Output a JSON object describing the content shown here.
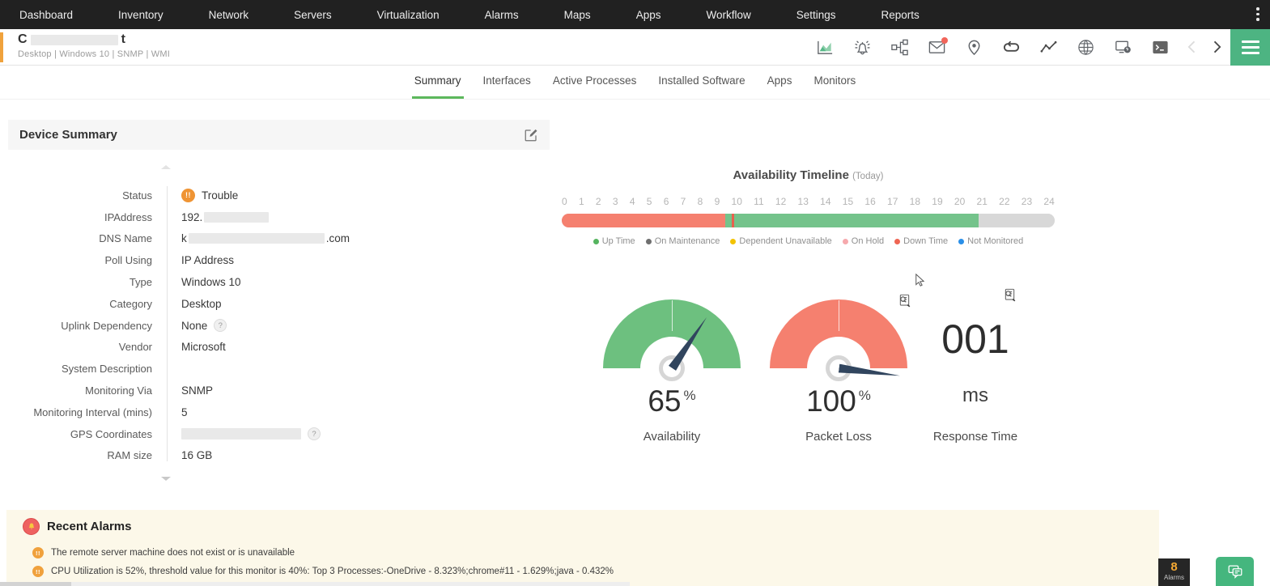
{
  "nav": {
    "items": [
      "Dashboard",
      "Inventory",
      "Network",
      "Servers",
      "Virtualization",
      "Alarms",
      "Maps",
      "Apps",
      "Workflow",
      "Settings",
      "Reports"
    ]
  },
  "device": {
    "name_prefix": "C",
    "name_suffix": "t",
    "meta": "Desktop | Windows 10  | SNMP  | WMI"
  },
  "header_icons": [
    "performance-chart",
    "alarm-bell",
    "topology",
    "mail-notification",
    "location-pin",
    "link-loop",
    "line-graph",
    "globe",
    "remote-session",
    "terminal"
  ],
  "tabs": [
    "Summary",
    "Interfaces",
    "Active Processes",
    "Installed Software",
    "Apps",
    "Monitors"
  ],
  "active_tab": "Summary",
  "summary": {
    "title": "Device Summary",
    "fields": {
      "status": {
        "label": "Status",
        "value": "Trouble"
      },
      "ip": {
        "label": "IPAddress",
        "prefix": "192."
      },
      "dns": {
        "label": "DNS Name",
        "prefix": "k",
        "suffix": ".com"
      },
      "poll": {
        "label": "Poll Using",
        "value": "IP Address"
      },
      "type": {
        "label": "Type",
        "value": "Windows 10"
      },
      "category": {
        "label": "Category",
        "value": "Desktop"
      },
      "uplink": {
        "label": "Uplink Dependency",
        "value": "None",
        "help": "?"
      },
      "vendor": {
        "label": "Vendor",
        "value": "Microsoft"
      },
      "sysdesc": {
        "label": "System Description",
        "value": ""
      },
      "monvia": {
        "label": "Monitoring Via",
        "value": "SNMP"
      },
      "interval": {
        "label": "Monitoring Interval (mins)",
        "value": "5"
      },
      "gps": {
        "label": "GPS Coordinates",
        "help": "?"
      },
      "ram": {
        "label": "RAM size",
        "value": "16 GB"
      }
    }
  },
  "timeline": {
    "title": "Availability Timeline",
    "period": "(Today)",
    "hours": [
      "0",
      "1",
      "2",
      "3",
      "4",
      "5",
      "6",
      "7",
      "8",
      "9",
      "10",
      "11",
      "12",
      "13",
      "14",
      "15",
      "16",
      "17",
      "18",
      "19",
      "20",
      "21",
      "22",
      "23",
      "24"
    ],
    "segments": [
      {
        "status": "down",
        "color": "#f5806f",
        "percent": 33.2
      },
      {
        "status": "up",
        "color": "#74c38b",
        "percent": 1.3
      },
      {
        "status": "down",
        "color": "#e8614e",
        "percent": 0.5
      },
      {
        "status": "up",
        "color": "#74c38b",
        "percent": 49.6
      },
      {
        "status": "not-monitored",
        "color": "#d8d8d8",
        "percent": 15.4
      }
    ],
    "legend": [
      {
        "label": "Up Time",
        "color": "#55b45f"
      },
      {
        "label": "On Maintenance",
        "color": "#6f6f6f"
      },
      {
        "label": "Dependent Unavailable",
        "color": "#f3c301"
      },
      {
        "label": "On Hold",
        "color": "#f6a9ad"
      },
      {
        "label": "Down Time",
        "color": "#ef6553"
      },
      {
        "label": "Not Monitored",
        "color": "#2a8fe8"
      }
    ]
  },
  "gauges": [
    {
      "label": "Availability",
      "value": "65",
      "unit": "%",
      "color": "#6dc07f",
      "needle_deg": 34
    },
    {
      "label": "Packet Loss",
      "value": "100",
      "unit": "%",
      "color": "#f5806f",
      "needle_deg": 97
    },
    {
      "label": "Response Time",
      "value": "001",
      "unit": "ms"
    }
  ],
  "alarms": {
    "title": "Recent Alarms",
    "items": [
      "The remote server machine does not exist or is unavailable",
      "CPU Utilization is 52%, threshold value for this monitor is 40%: Top 3 Processes:-OneDrive - 8.323%;chrome#11 - 1.629%;java - 0.432%"
    ]
  },
  "footer": {
    "alarm_count": "8",
    "alarm_label": "Alarms"
  }
}
